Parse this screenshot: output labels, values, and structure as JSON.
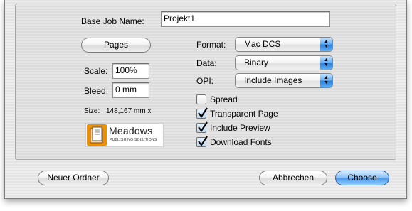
{
  "dialog": {
    "base_job_name_label": "Base Job Name:",
    "base_job_name_value": "Projekt1",
    "pages_button": "Pages",
    "scale_label": "Scale:",
    "scale_value": "100%",
    "bleed_label": "Bleed:",
    "bleed_value": "0 mm",
    "size_label": "Size:",
    "size_value": "148,167 mm x",
    "format_label": "Format:",
    "format_value": "Mac DCS",
    "data_label": "Data:",
    "data_value": "Binary",
    "opi_label": "OPI:",
    "opi_value": "Include Images",
    "checkboxes": [
      {
        "label": "Spread",
        "checked": false
      },
      {
        "label": "Transparent Page",
        "checked": true
      },
      {
        "label": "Include Preview",
        "checked": true
      },
      {
        "label": "Download Fonts",
        "checked": true
      }
    ],
    "logo": {
      "name": "Meadows",
      "tagline": "PUBLISHING SOLUTIONS"
    }
  },
  "footer": {
    "new_folder_button": "Neuer Ordner",
    "cancel_button": "Abbrechen",
    "choose_button": "Choose"
  },
  "colors": {
    "accent": "#4e9ae8",
    "logo_orange": "#e8900a"
  },
  "icons": {
    "popup_arrows": "up-down-arrows-icon",
    "checkmark": "checkmark-icon"
  }
}
